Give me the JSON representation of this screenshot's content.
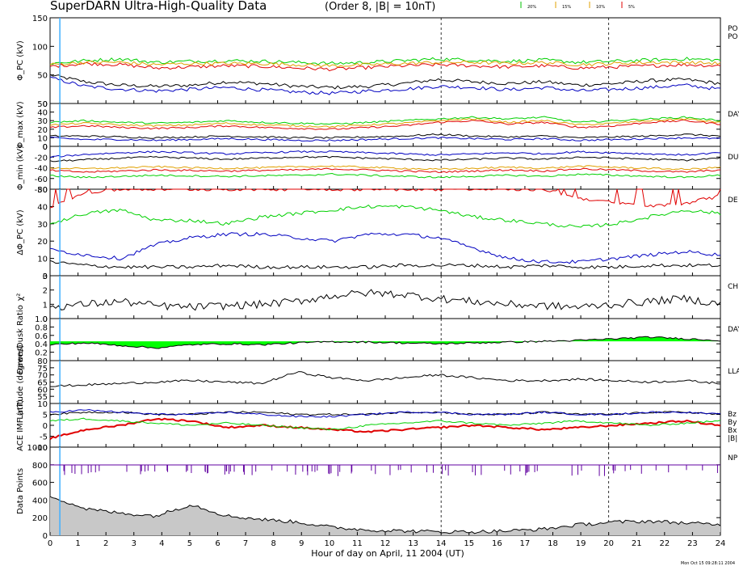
{
  "header": {
    "title": "SuperDARN Ultra-High-Quality Data",
    "subtitle": "(Order 8, |B| = 10nT)",
    "pct_labels": [
      "20%",
      "15%",
      "10%",
      "5%"
    ],
    "pct_colors": [
      "#00c000",
      "#e0a000",
      "#e0a000",
      "#e00000"
    ]
  },
  "footer": {
    "timestamp": "Mon Oct 15 09:28:11 2004"
  },
  "colors": {
    "black": "#000000",
    "blue": "#0000c0",
    "red": "#e00000",
    "green": "#00d000",
    "orange": "#e0a000",
    "fill_green": "#00ff00",
    "gray_fill": "#c8c8c8",
    "purple": "#6000a0",
    "cyan_marker": "#40b0ff"
  },
  "chart_data": [
    {
      "id": "p1",
      "type": "line",
      "ylabel": "Φ_PC (kV)",
      "ylim": [
        0,
        150
      ],
      "yticks": [
        "0",
        "50",
        "100",
        "150"
      ],
      "right_labels": [
        "PO",
        "PO"
      ],
      "series_levels": {
        "black": [
          50,
          38,
          32,
          30,
          32,
          38,
          35,
          30,
          28,
          30,
          35,
          42,
          38,
          35,
          38,
          32,
          35,
          40,
          42,
          35
        ],
        "blue": [
          45,
          30,
          25,
          22,
          25,
          28,
          24,
          20,
          18,
          22,
          25,
          30,
          28,
          24,
          28,
          22,
          25,
          28,
          32,
          25
        ],
        "red": [
          65,
          70,
          68,
          62,
          64,
          66,
          65,
          62,
          60,
          63,
          66,
          68,
          66,
          64,
          66,
          62,
          64,
          66,
          68,
          66
        ],
        "green": [
          70,
          75,
          78,
          72,
          74,
          75,
          74,
          72,
          70,
          72,
          75,
          78,
          76,
          74,
          76,
          72,
          74,
          76,
          78,
          76
        ],
        "orange": [
          68,
          72,
          72,
          68,
          70,
          70,
          70,
          68,
          66,
          68,
          70,
          72,
          72,
          70,
          72,
          68,
          70,
          72,
          72,
          70
        ]
      }
    },
    {
      "id": "p2",
      "type": "line",
      "ylabel": "Φ_max (kV)",
      "ylim": [
        0,
        50
      ],
      "yticks": [
        "0",
        "10",
        "20",
        "30",
        "40",
        "50"
      ],
      "right_labels": [
        "DAY"
      ],
      "series_levels": {
        "black": [
          12,
          12,
          11,
          10,
          11,
          12,
          11,
          10,
          10,
          11,
          12,
          14,
          12,
          11,
          12,
          10,
          11,
          12,
          14,
          12
        ],
        "blue": [
          10,
          8,
          8,
          7,
          8,
          9,
          8,
          7,
          7,
          8,
          9,
          10,
          9,
          8,
          9,
          7,
          8,
          9,
          10,
          9
        ],
        "red": [
          22,
          24,
          22,
          21,
          22,
          24,
          22,
          21,
          20,
          22,
          24,
          28,
          30,
          26,
          28,
          22,
          24,
          28,
          30,
          26
        ],
        "green": [
          28,
          30,
          28,
          27,
          28,
          30,
          28,
          27,
          26,
          28,
          30,
          32,
          34,
          32,
          34,
          28,
          30,
          32,
          34,
          30
        ],
        "orange": [
          25,
          27,
          25,
          24,
          25,
          27,
          25,
          24,
          23,
          25,
          27,
          30,
          32,
          28,
          30,
          25,
          27,
          30,
          32,
          28
        ]
      }
    },
    {
      "id": "p3",
      "type": "line",
      "ylabel": "Φ_min (kV)",
      "ylim": [
        -80,
        0
      ],
      "yticks": [
        "-80",
        "-60",
        "-40",
        "-20",
        "0"
      ],
      "right_labels": [
        "DU"
      ],
      "series_levels": {
        "black": [
          -28,
          -25,
          -22,
          -20,
          -22,
          -24,
          -22,
          -20,
          -20,
          -22,
          -24,
          -26,
          -24,
          -22,
          -24,
          -20,
          -22,
          -24,
          -26,
          -22
        ],
        "blue": [
          -20,
          -15,
          -12,
          -10,
          -12,
          -14,
          -12,
          -10,
          -10,
          -12,
          -14,
          -16,
          -14,
          -12,
          -14,
          -10,
          -12,
          -14,
          -16,
          -12
        ],
        "red": [
          -45,
          -48,
          -46,
          -44,
          -45,
          -46,
          -45,
          -44,
          -42,
          -44,
          -46,
          -48,
          -46,
          -44,
          -46,
          -42,
          -44,
          -46,
          -48,
          -44
        ],
        "green": [
          -55,
          -58,
          -56,
          -54,
          -55,
          -56,
          -55,
          -54,
          -52,
          -54,
          -56,
          -58,
          -56,
          -54,
          -56,
          -52,
          -54,
          -56,
          -58,
          -54
        ],
        "orange": [
          -40,
          -42,
          -40,
          -38,
          -40,
          -41,
          -40,
          -38,
          -37,
          -39,
          -41,
          -43,
          -41,
          -39,
          -41,
          -37,
          -39,
          -41,
          -43,
          -39
        ]
      }
    },
    {
      "id": "p4",
      "type": "line",
      "ylabel": "ΔΦ_PC (kV)",
      "ylim": [
        0,
        50
      ],
      "yticks": [
        "0",
        "10",
        "20",
        "30",
        "40",
        "50"
      ],
      "right_labels": [
        "DE"
      ],
      "series_levels": {
        "black": [
          8,
          6,
          5,
          5,
          5,
          6,
          5,
          5,
          5,
          5,
          6,
          6,
          6,
          5,
          6,
          5,
          5,
          6,
          6,
          6
        ],
        "blue": [
          15,
          12,
          10,
          18,
          22,
          24,
          24,
          22,
          20,
          24,
          24,
          22,
          16,
          10,
          8,
          8,
          10,
          12,
          14,
          12
        ],
        "red": [
          40,
          48,
          50,
          50,
          50,
          50,
          50,
          50,
          50,
          50,
          50,
          50,
          50,
          50,
          50,
          45,
          42,
          40,
          42,
          46
        ],
        "green": [
          30,
          36,
          38,
          32,
          32,
          30,
          34,
          36,
          38,
          40,
          40,
          38,
          34,
          32,
          30,
          28,
          30,
          34,
          38,
          36
        ]
      }
    },
    {
      "id": "p5",
      "type": "line",
      "ylabel": "χ²",
      "ylim": [
        0,
        3
      ],
      "yticks": [
        "0",
        "1",
        "2",
        "3"
      ],
      "right_labels": [
        "CH"
      ],
      "series_levels": {
        "black": [
          0.8,
          1.0,
          1.2,
          0.9,
          0.8,
          0.9,
          1.0,
          1.2,
          1.6,
          1.8,
          1.7,
          1.4,
          1.2,
          1.0,
          0.9,
          0.8,
          1.0,
          1.2,
          1.4,
          1.0
        ]
      }
    },
    {
      "id": "p6",
      "type": "area",
      "ylabel": "Dawn/Dusk Ratio",
      "ylim": [
        0,
        1.0
      ],
      "yticks": [
        "0.2",
        "0.4",
        "0.6",
        "0.8",
        "1.0"
      ],
      "right_labels": [
        "DAY"
      ],
      "series_levels": {
        "black": [
          0.38,
          0.42,
          0.36,
          0.3,
          0.38,
          0.4,
          0.38,
          0.42,
          0.45,
          0.44,
          0.42,
          0.4,
          0.42,
          0.44,
          0.46,
          0.48,
          0.52,
          0.56,
          0.52,
          0.48
        ]
      }
    },
    {
      "id": "p7",
      "type": "line",
      "ylabel": "Latitude (degrees)",
      "ylim": [
        50,
        80
      ],
      "yticks": [
        "55",
        "60",
        "65",
        "70",
        "75",
        "80"
      ],
      "right_labels": [
        "LLA"
      ],
      "series_levels": {
        "black": [
          62,
          63,
          64,
          65,
          66,
          65,
          64,
          72,
          68,
          66,
          68,
          70,
          68,
          66,
          66,
          67,
          66,
          65,
          66,
          64
        ]
      }
    },
    {
      "id": "p8",
      "type": "line",
      "ylabel": "ACE IMF (nT)",
      "ylim": [
        -10,
        10
      ],
      "yticks": [
        "-10",
        "-5",
        "0",
        "5",
        "10"
      ],
      "right_labels": [
        "Bz",
        "By",
        "Bx",
        "|B|"
      ],
      "series_levels": {
        "black": [
          5,
          6,
          6,
          5,
          5,
          6,
          6,
          5,
          5,
          5,
          6,
          6,
          5,
          5,
          6,
          5,
          5,
          6,
          6,
          5
        ],
        "blue": [
          6,
          7,
          6,
          5,
          5,
          6,
          5,
          4,
          4,
          5,
          6,
          6,
          5,
          5,
          6,
          5,
          5,
          6,
          6,
          5
        ],
        "red": [
          -6,
          -2,
          0,
          3,
          2,
          -1,
          0,
          -1,
          -2,
          -3,
          -2,
          -1,
          0,
          -1,
          -2,
          -1,
          0,
          1,
          2,
          0
        ],
        "green": [
          2,
          3,
          2,
          1,
          0,
          1,
          0,
          -1,
          -2,
          0,
          1,
          2,
          1,
          0,
          1,
          2,
          1,
          0,
          1,
          2
        ]
      }
    },
    {
      "id": "p9",
      "type": "area",
      "ylabel": "Data Points",
      "ylim": [
        0,
        1000
      ],
      "yticks": [
        "0",
        "200",
        "400",
        "600",
        "800",
        "1000"
      ],
      "right_labels": [
        "NP"
      ],
      "series_levels": {
        "black": [
          450,
          300,
          250,
          220,
          350,
          220,
          180,
          150,
          90,
          60,
          50,
          40,
          40,
          50,
          70,
          120,
          150,
          160,
          140,
          120
        ]
      }
    }
  ],
  "xaxis": {
    "label": "Hour of day on April, 11 2004 (UT)",
    "xlim": [
      0,
      24
    ],
    "ticks": [
      "0",
      "1",
      "2",
      "3",
      "4",
      "5",
      "6",
      "7",
      "8",
      "9",
      "10",
      "11",
      "12",
      "13",
      "14",
      "15",
      "16",
      "17",
      "18",
      "19",
      "20",
      "21",
      "22",
      "23",
      "24"
    ],
    "dashed_hours": [
      14,
      20
    ],
    "marker_hour": 0.35
  }
}
